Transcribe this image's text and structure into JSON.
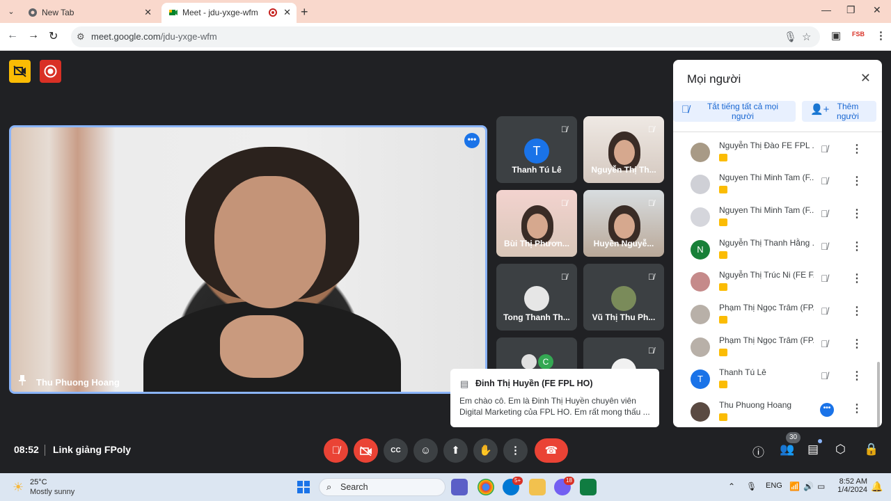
{
  "browser": {
    "tabs": [
      {
        "title": "New Tab",
        "active": false
      },
      {
        "title": "Meet - jdu-yxge-wfm",
        "active": true
      }
    ],
    "url_domain": "meet.google.com",
    "url_path": "/jdu-yxge-wfm",
    "ext_label": "FSB"
  },
  "meet": {
    "main_speaker": "Thu Phuong Hoang",
    "tiles": [
      {
        "name": "Thanh Tú Lê",
        "initial": "T",
        "avatar_color": "#1a73e8"
      },
      {
        "name": "Nguyễn Thị Th...",
        "video": true
      },
      {
        "name": "Bùi Thị Phươn...",
        "video": true
      },
      {
        "name": "Huyền Nguyễ...",
        "video": true
      },
      {
        "name": "Tong Thanh Th...",
        "photo": true
      },
      {
        "name": "Vũ Thị Thu Ph...",
        "photo": true
      },
      {
        "name": "",
        "initial": "C",
        "avatar_color": "#34a853"
      },
      {
        "name": "",
        "photo": true
      }
    ],
    "time": "08:52",
    "meeting_name": "Link giảng FPoly",
    "participant_count": "30"
  },
  "people_panel": {
    "title": "Mọi người",
    "mute_all_label": "Tắt tiếng tất cả mọi người",
    "add_label": "Thêm người",
    "people": [
      {
        "name": "Nguyễn Thị Đào FE FPL ...",
        "avatar": "photo"
      },
      {
        "name": "Nguyen Thi Minh Tam (F...",
        "avatar": "photo"
      },
      {
        "name": "Nguyen Thi Minh Tam (F...",
        "avatar": "photo"
      },
      {
        "name": "Nguyễn Thị Thanh Hằng ...",
        "avatar": "initial",
        "initial": "N",
        "color": "#188038"
      },
      {
        "name": "Nguyễn Thị Trúc Ni (FE F...",
        "avatar": "photo"
      },
      {
        "name": "Phạm Thị Ngọc Trâm (FP...",
        "avatar": "photo"
      },
      {
        "name": "Phạm Thị Ngọc Trâm (FP...",
        "avatar": "photo"
      },
      {
        "name": "Thanh Tú Lê",
        "avatar": "initial",
        "initial": "T",
        "color": "#1a73e8"
      },
      {
        "name": "Thu Phuong Hoang",
        "avatar": "photo",
        "speaking": true
      }
    ]
  },
  "chat_toast": {
    "sender": "Đinh Thị Huyền (FE FPL HO)",
    "message": "Em chào cô. Em là Đinh Thị Huyền chuyên viên Digital Marketing của FPL HO. Em rất mong thấu ..."
  },
  "taskbar": {
    "temperature": "25°C",
    "condition": "Mostly sunny",
    "search_placeholder": "Search",
    "badge_1": "5+",
    "badge_2": "18",
    "lang": "ENG",
    "clock_time": "8:52 AM",
    "clock_date": "1/4/2024"
  }
}
